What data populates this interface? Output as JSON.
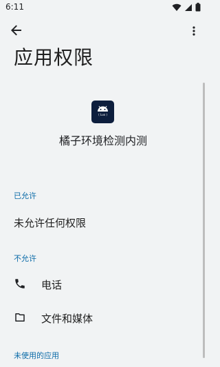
{
  "status_bar": {
    "time": "6:11"
  },
  "header": {
    "title": "应用权限"
  },
  "app": {
    "name": "橘子环境检测内测",
    "icon_label": "( Luo )"
  },
  "sections": {
    "allowed": {
      "title": "已允许",
      "empty_text": "未允许任何权限"
    },
    "not_allowed": {
      "title": "不允许",
      "items": [
        {
          "label": "电话",
          "icon": "phone-icon"
        },
        {
          "label": "文件和媒体",
          "icon": "folder-icon"
        }
      ]
    },
    "unused": {
      "title": "未使用的应用"
    }
  },
  "colors": {
    "accent": "#0B6BA8",
    "background": "#F1F3F4",
    "app_icon_bg": "#0D1E3D"
  }
}
